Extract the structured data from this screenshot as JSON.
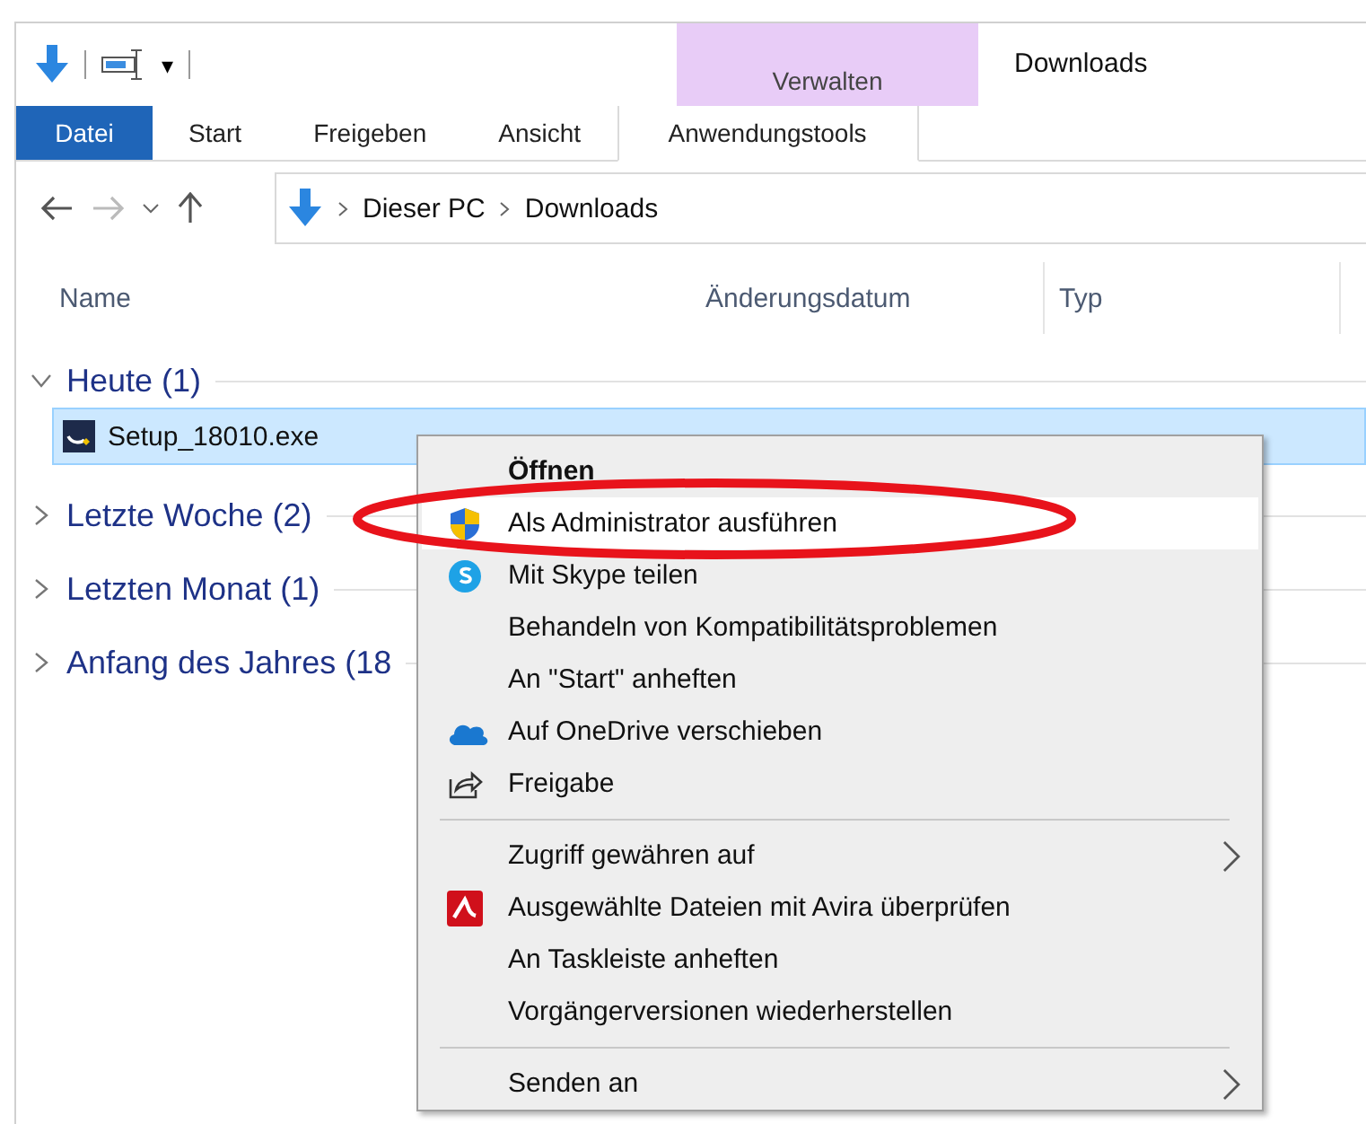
{
  "window": {
    "title": "Downloads"
  },
  "quick_access": {
    "dropdown": "▾"
  },
  "contextual_header": "Verwalten",
  "ribbon_tabs": [
    {
      "label": "Datei",
      "kind": "file"
    },
    {
      "label": "Start",
      "kind": "plain"
    },
    {
      "label": "Freigeben",
      "kind": "plain"
    },
    {
      "label": "Ansicht",
      "kind": "plain"
    },
    {
      "label": "Anwendungstools",
      "kind": "contextual"
    }
  ],
  "address_bar": {
    "path": [
      "Dieser PC",
      "Downloads"
    ]
  },
  "columns": [
    "Name",
    "Änderungsdatum",
    "Typ"
  ],
  "groups": [
    {
      "label": "Heute (1)",
      "expanded": true,
      "children": [
        {
          "name": "Setup_18010.exe",
          "selected": true
        }
      ]
    },
    {
      "label": "Letzte Woche (2)",
      "expanded": false
    },
    {
      "label": "Letzten Monat (1)",
      "expanded": false
    },
    {
      "label": "Anfang des Jahres (18",
      "expanded": false
    }
  ],
  "context_menu": [
    {
      "kind": "plain",
      "label": "Öffnen",
      "default": true,
      "selected": false
    },
    {
      "kind": "shield",
      "label": "Als Administrator ausführen",
      "default": false,
      "selected": true
    },
    {
      "kind": "skype",
      "label": "Mit Skype teilen",
      "default": false,
      "selected": false
    },
    {
      "kind": "plain",
      "label": "Behandeln von Kompatibilitätsproblemen",
      "default": false,
      "selected": false
    },
    {
      "kind": "plain",
      "label": "An \"Start\" anheften",
      "default": false,
      "selected": false
    },
    {
      "kind": "cloud",
      "label": "Auf OneDrive verschieben",
      "default": false,
      "selected": false
    },
    {
      "kind": "share",
      "label": "Freigabe",
      "default": false,
      "selected": false
    },
    {
      "kind": "separator"
    },
    {
      "kind": "submenu",
      "label": "Zugriff gewähren auf",
      "default": false,
      "selected": false
    },
    {
      "kind": "avira",
      "label": "Ausgewählte Dateien mit Avira überprüfen",
      "default": false,
      "selected": false
    },
    {
      "kind": "plain",
      "label": "An Taskleiste anheften",
      "default": false,
      "selected": false
    },
    {
      "kind": "plain",
      "label": "Vorgängerversionen wiederherstellen",
      "default": false,
      "selected": false
    },
    {
      "kind": "separator"
    },
    {
      "kind": "submenu",
      "label": "Senden an",
      "default": false,
      "selected": false
    }
  ]
}
